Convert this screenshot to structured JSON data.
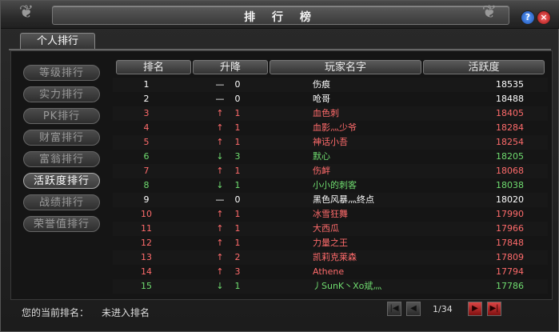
{
  "window": {
    "title": "排 行 榜"
  },
  "tabs": [
    {
      "label": "个人排行"
    }
  ],
  "sidebar": {
    "items": [
      {
        "label": "等级排行",
        "active": false
      },
      {
        "label": "实力排行",
        "active": false
      },
      {
        "label": "PK排行",
        "active": false
      },
      {
        "label": "财富排行",
        "active": false
      },
      {
        "label": "富翁排行",
        "active": false
      },
      {
        "label": "活跃度排行",
        "active": true
      },
      {
        "label": "战绩排行",
        "active": false
      },
      {
        "label": "荣誉值排行",
        "active": false
      }
    ]
  },
  "table": {
    "headers": {
      "rank": "排名",
      "change": "升降",
      "name": "玩家名字",
      "activity": "活跃度"
    },
    "rows": [
      {
        "rank": "1",
        "arrow": "—",
        "change": "0",
        "name": "伤痕",
        "activity": "18535",
        "color": "#ffffff"
      },
      {
        "rank": "2",
        "arrow": "—",
        "change": "0",
        "name": "呛哥",
        "activity": "18488",
        "color": "#ffffff"
      },
      {
        "rank": "3",
        "arrow": "↑",
        "change": "1",
        "name": "血色刺",
        "activity": "18405",
        "color": "#ff6b6b"
      },
      {
        "rank": "4",
        "arrow": "↑",
        "change": "1",
        "name": "血影灬少爷",
        "activity": "18284",
        "color": "#ff6b6b"
      },
      {
        "rank": "5",
        "arrow": "↑",
        "change": "1",
        "name": "神话小吾",
        "activity": "18254",
        "color": "#ff6b6b"
      },
      {
        "rank": "6",
        "arrow": "↓",
        "change": "3",
        "name": "默心",
        "activity": "18205",
        "color": "#6fdc6f"
      },
      {
        "rank": "7",
        "arrow": "↑",
        "change": "1",
        "name": "伤衅",
        "activity": "18068",
        "color": "#ff6b6b"
      },
      {
        "rank": "8",
        "arrow": "↓",
        "change": "1",
        "name": "小小的刺客",
        "activity": "18038",
        "color": "#6fdc6f"
      },
      {
        "rank": "9",
        "arrow": "—",
        "change": "0",
        "name": "黑色风暴灬终点",
        "activity": "18020",
        "color": "#ffffff"
      },
      {
        "rank": "10",
        "arrow": "↑",
        "change": "1",
        "name": "冰雪狂舞",
        "activity": "17990",
        "color": "#ff6b6b"
      },
      {
        "rank": "11",
        "arrow": "↑",
        "change": "1",
        "name": "大西瓜",
        "activity": "17966",
        "color": "#ff6b6b"
      },
      {
        "rank": "12",
        "arrow": "↑",
        "change": "1",
        "name": "力量之王",
        "activity": "17848",
        "color": "#ff6b6b"
      },
      {
        "rank": "13",
        "arrow": "↑",
        "change": "2",
        "name": "凯莉克莱森",
        "activity": "17809",
        "color": "#ff6b6b"
      },
      {
        "rank": "14",
        "arrow": "↑",
        "change": "3",
        "name": "Athene",
        "activity": "17794",
        "color": "#ff6b6b"
      },
      {
        "rank": "15",
        "arrow": "↓",
        "change": "1",
        "name": "丿SunK丶Xo斌灬",
        "activity": "17786",
        "color": "#6fdc6f"
      }
    ]
  },
  "footer": {
    "label": "您的当前排名：",
    "value": "未进入排名",
    "page": "1/34"
  },
  "icons": {
    "help": "help-icon",
    "close": "close-icon",
    "first": "first-page-icon",
    "prev": "prev-page-icon",
    "next": "next-page-icon",
    "last": "last-page-icon"
  }
}
